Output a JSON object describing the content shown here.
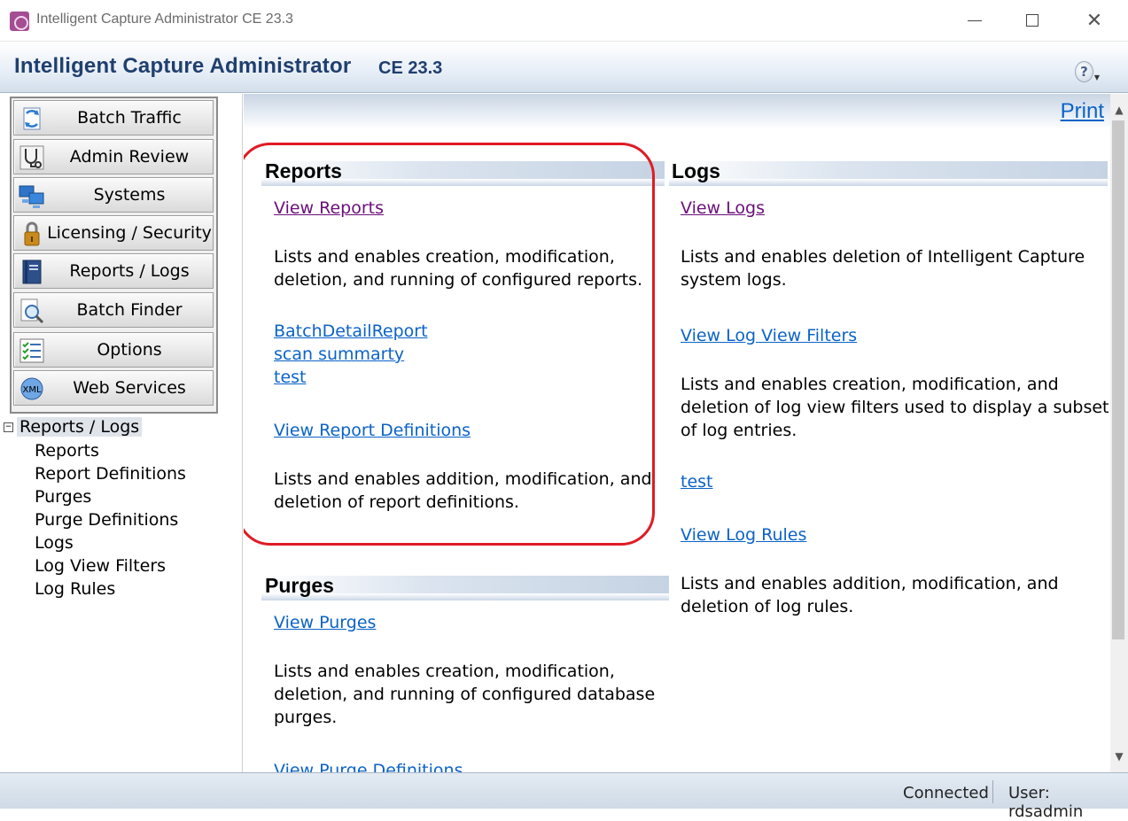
{
  "window": {
    "title": "Intelligent Capture Administrator CE 23.3",
    "min_icon": "minimize-icon",
    "max_icon": "maximize-icon",
    "close_icon": "close-icon",
    "close_glyph": "✕"
  },
  "header": {
    "title": "Intelligent Capture Administrator",
    "version": "CE 23.3",
    "help_glyph": "?",
    "help_caret": "▼"
  },
  "nav": {
    "buttons": [
      {
        "label": "Batch Traffic",
        "icon": "batch-traffic-icon"
      },
      {
        "label": "Admin Review",
        "icon": "stethoscope-icon"
      },
      {
        "label": "Systems",
        "icon": "computers-icon"
      },
      {
        "label": "Licensing / Security",
        "icon": "padlock-icon"
      },
      {
        "label": "Reports / Logs",
        "icon": "book-icon"
      },
      {
        "label": "Batch Finder",
        "icon": "magnifier-icon"
      },
      {
        "label": "Options",
        "icon": "checklist-icon"
      },
      {
        "label": "Web Services",
        "icon": "xml-icon"
      }
    ]
  },
  "tree": {
    "toggle": "−",
    "root": "Reports / Logs",
    "items": [
      "Reports",
      "Report Definitions",
      "Purges",
      "Purge Definitions",
      "Logs",
      "Log View Filters",
      "Log Rules"
    ]
  },
  "main": {
    "print": "Print",
    "reports": {
      "title": "Reports",
      "view_link": "View Reports",
      "view_desc_1": "Lists and enables creation, modification,",
      "view_desc_2": "deletion, and running of configured reports.",
      "report_links": [
        "BatchDetailReport",
        "scan summarty",
        "test"
      ],
      "defs_link": "View Report Definitions",
      "defs_desc_1": "Lists and enables addition, modification, and",
      "defs_desc_2": "deletion of report definitions."
    },
    "purges": {
      "title": "Purges",
      "view_link": "View Purges",
      "view_desc_1": "Lists and enables creation, modification,",
      "view_desc_2": "deletion, and running of configured database",
      "view_desc_3": "purges.",
      "defs_link_partial": "View Purge Definitions"
    },
    "logs": {
      "title": "Logs",
      "view_link": "View Logs",
      "view_desc_1": "Lists and enables deletion of Intelligent Capture",
      "view_desc_2": "system logs.",
      "filters_link": "View Log View Filters",
      "filters_desc_1": "Lists and enables creation, modification, and",
      "filters_desc_2": "deletion of log view filters used to display a subset",
      "filters_desc_3": "of log entries.",
      "filter_item": "test",
      "rules_link": "View Log Rules",
      "rules_desc_1": "Lists and enables addition, modification, and",
      "rules_desc_2": "deletion of log rules."
    }
  },
  "scrollbar": {
    "up": "▲",
    "down": "▼"
  },
  "status": {
    "connection": "Connected",
    "user": "User: rdsadmin"
  },
  "colors": {
    "link": "#0b63c8",
    "visited_link": "#6b0f7a",
    "highlight": "#e01b24",
    "header_text": "#1f3f6e"
  }
}
